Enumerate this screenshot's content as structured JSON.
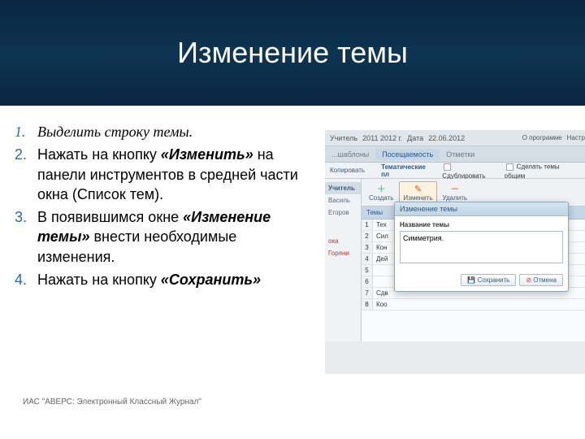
{
  "header": {
    "title": "Изменение темы"
  },
  "steps": [
    {
      "text": "Выделить строку темы."
    },
    {
      "html": "Нажать на кнопку <strong><em>«Изменить»</em></strong> на панели инструментов в средней части окна (Список тем)."
    },
    {
      "html": "В появившимся окне <strong><em>«Изменение темы»</em></strong> внести необходимые изменения."
    },
    {
      "html": "Нажать на кнопку <strong><em>«Сохранить»</em></strong>"
    }
  ],
  "footer": "ИАС \"АВЕРС: Электронный Классный Журнал\"",
  "mock": {
    "top": {
      "teacher_lbl": "Учитель",
      "year": "2011 2012 г.",
      "date_lbl": "Дата",
      "date": "22.06.2012",
      "links": [
        "О программе",
        "Настр"
      ]
    },
    "tabs": [
      "...шаблоны",
      "Посещаемость",
      "Отметки"
    ],
    "sidebar": {
      "header": "Учитель",
      "items": [
        "Василь",
        "Егоров"
      ],
      "warn_row": "Горяни",
      "warn_lbl": "ока"
    },
    "toolbar": {
      "create": "Создать",
      "edit": "Изменить",
      "copy": "Копировать",
      "delete": "Удалить",
      "duplicate": "Сдублировать",
      "split": "Сделать темы общим"
    },
    "plan_header": "Тематические пл",
    "themes_header": "Темы",
    "themes": [
      {
        "n": "1",
        "txt": "Тех"
      },
      {
        "n": "2",
        "txt": "Сил"
      },
      {
        "n": "3",
        "txt": "Кон"
      },
      {
        "n": "4",
        "txt": "Дей"
      },
      {
        "n": "5",
        "txt": ""
      },
      {
        "n": "6",
        "txt": ""
      },
      {
        "n": "7",
        "txt": "Сдв"
      },
      {
        "n": "8",
        "txt": "Коо"
      }
    ],
    "dialog": {
      "title": "Изменение темы",
      "label": "Название темы",
      "value": "Симметрия.",
      "save": "Сохранить",
      "cancel": "Отмена"
    }
  }
}
